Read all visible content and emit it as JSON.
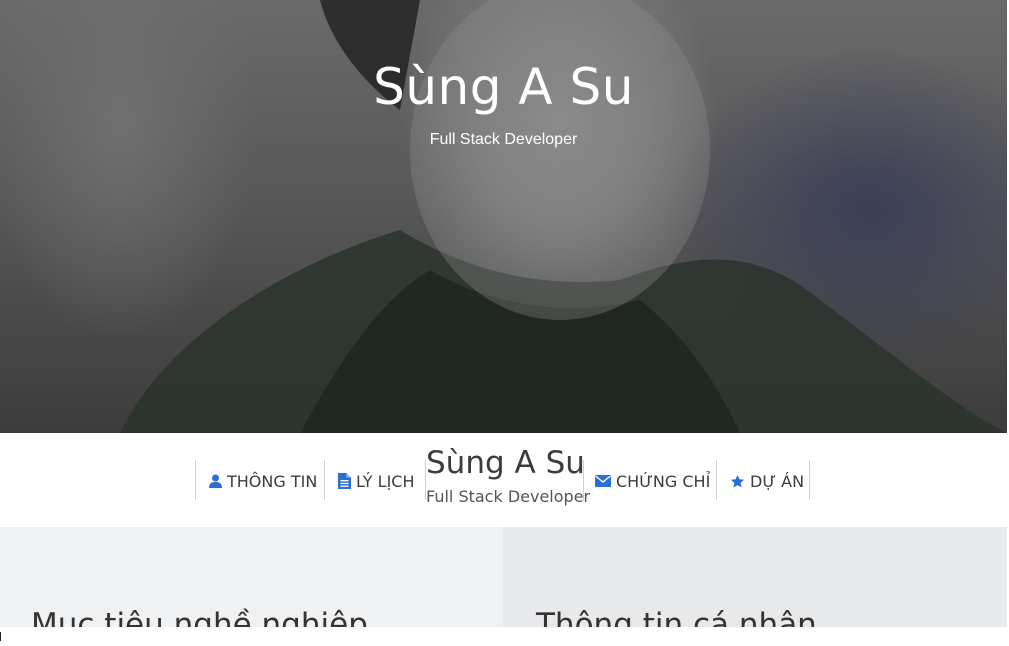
{
  "hero": {
    "title": "Sùng A Su",
    "subtitle": "Full Stack Developer"
  },
  "nav": {
    "items": [
      {
        "label": "THÔNG TIN",
        "icon": "user-icon"
      },
      {
        "label": "LÝ LỊCH",
        "icon": "document-icon"
      },
      {
        "label": "CHỨNG CHỈ",
        "icon": "envelope-icon"
      },
      {
        "label": "DỰ ÁN",
        "icon": "star-icon"
      }
    ],
    "brand": {
      "name": "Sùng A Su",
      "subtitle": "Full Stack Developer"
    }
  },
  "sections": {
    "left_title": "Mục tiêu nghề nghiệp",
    "right_title": "Thông tin cá nhân"
  },
  "colors": {
    "icon_blue": "#2a6fd6",
    "text_dark": "#3c3c3c",
    "left_panel_bg": "#f0f1f3",
    "right_panel_bg": "#e8e9eb"
  }
}
